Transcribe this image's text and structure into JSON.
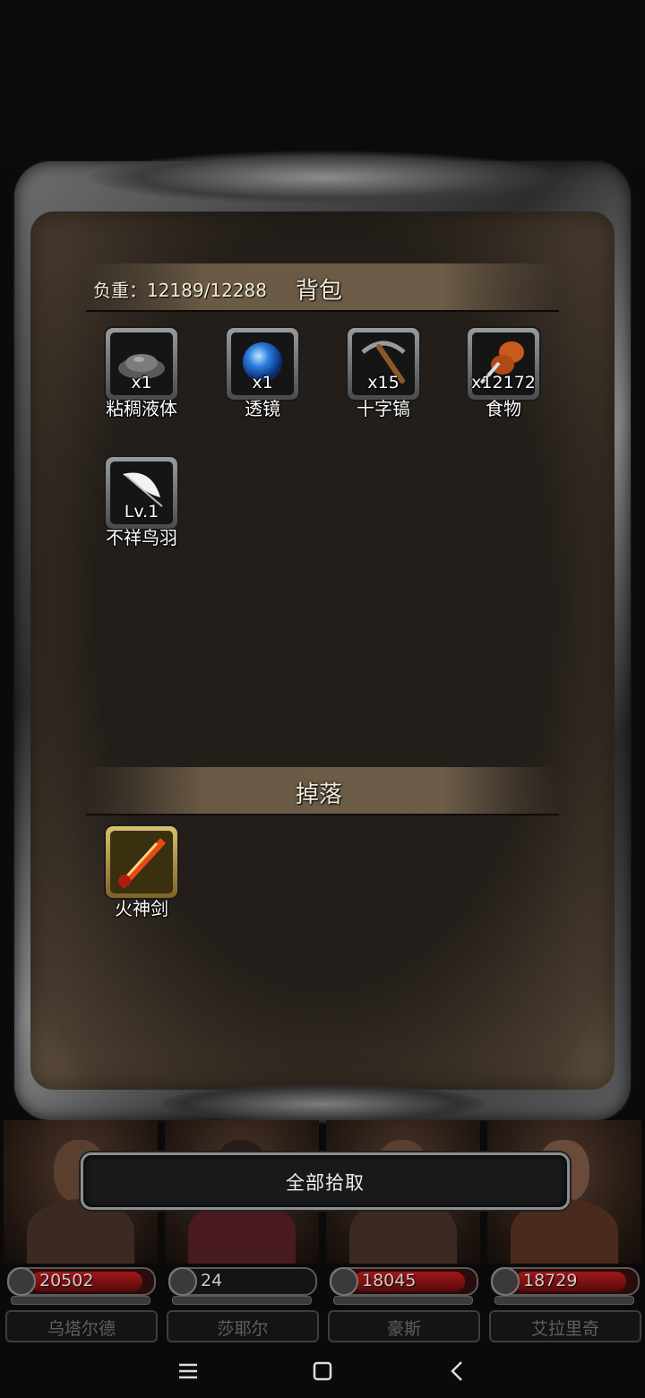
{
  "bag": {
    "title": "背包",
    "load_label": "负重：12189/12288",
    "items": [
      {
        "qty": "x1",
        "name": "粘稠液体",
        "icon": "slime-icon"
      },
      {
        "qty": "x1",
        "name": "透镜",
        "icon": "lens-orb-icon"
      },
      {
        "qty": "x15",
        "name": "十字镐",
        "icon": "pickaxe-icon"
      },
      {
        "qty": "x12172",
        "name": "食物",
        "icon": "meat-icon"
      },
      {
        "qty": "Lv.1",
        "name": "不祥鸟羽",
        "icon": "feather-icon"
      }
    ]
  },
  "drops": {
    "title": "掉落",
    "items": [
      {
        "qty": "",
        "name": "火神剑",
        "icon": "fire-sword-icon"
      }
    ]
  },
  "pickup_all_label": "全部拾取",
  "party": [
    {
      "name": "乌塔尔德",
      "hp": "20502",
      "hp_fraction": 0.95
    },
    {
      "name": "莎耶尔",
      "hp": "24",
      "hp_fraction": 0.0
    },
    {
      "name": "豪斯",
      "hp": "18045",
      "hp_fraction": 0.95
    },
    {
      "name": "艾拉里奇",
      "hp": "18729",
      "hp_fraction": 0.95
    }
  ],
  "colors": {
    "parchment": "#231e19",
    "bar": "#6a5a45",
    "hp_red": "#a01818",
    "frame_silver": "#8a8b8d"
  }
}
